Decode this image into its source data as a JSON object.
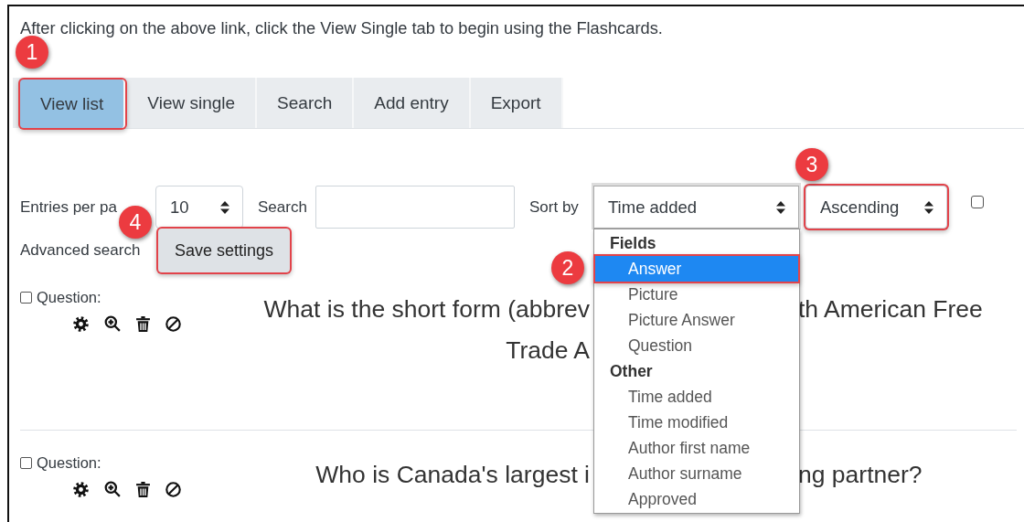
{
  "intro_text": "After clicking on the above link, click the View Single tab to begin using the Flashcards.",
  "tabs": [
    {
      "label": "View list",
      "selected": true,
      "highlighted": true,
      "badge": "1"
    },
    {
      "label": "View single",
      "selected": false,
      "highlighted": false
    },
    {
      "label": "Search",
      "selected": false,
      "highlighted": false
    },
    {
      "label": "Add entry",
      "selected": false,
      "highlighted": false
    },
    {
      "label": "Export",
      "selected": false,
      "highlighted": false
    }
  ],
  "controls": {
    "entries_label": "Entries per pa",
    "entries_select": {
      "value": "10"
    },
    "search_label": "Search",
    "sort_label": "Sort by",
    "sort_select": {
      "value": "Time added",
      "expanded": true
    },
    "order_select": {
      "value": "Ascending",
      "highlighted": true,
      "badge": "3"
    },
    "option_checkbox": {
      "checked": false
    },
    "advanced_label": "Advanced search",
    "save_button": {
      "label": "Save settings",
      "highlighted": true,
      "badge": "4"
    }
  },
  "sort_options": [
    {
      "kind": "group",
      "label": "Fields"
    },
    {
      "kind": "option",
      "label": "Answer",
      "selected": true,
      "highlighted": true,
      "badge": "2"
    },
    {
      "kind": "option",
      "label": "Picture",
      "selected": false,
      "highlighted": false
    },
    {
      "kind": "option",
      "label": "Picture Answer",
      "selected": false,
      "highlighted": false
    },
    {
      "kind": "option",
      "label": "Question",
      "selected": false,
      "highlighted": false
    },
    {
      "kind": "group",
      "label": "Other"
    },
    {
      "kind": "option",
      "label": "Time added",
      "selected": false,
      "highlighted": false
    },
    {
      "kind": "option",
      "label": "Time modified",
      "selected": false,
      "highlighted": false
    },
    {
      "kind": "option",
      "label": "Author first name",
      "selected": false,
      "highlighted": false
    },
    {
      "kind": "option",
      "label": "Author surname",
      "selected": false,
      "highlighted": false
    },
    {
      "kind": "option",
      "label": "Approved",
      "selected": false,
      "highlighted": false
    }
  ],
  "entries": [
    {
      "checked": false,
      "label": "Question:",
      "question_lines": [
        {
          "visible_start": "What is the short form (abbrev",
          "visible_end": "th American Free"
        },
        {
          "visible_start": "Trade A"
        }
      ]
    },
    {
      "checked": false,
      "label": "Question:",
      "question_lines": [
        {
          "visible_start": "Who is Canada's largest i",
          "visible_end": "ng partner?"
        }
      ]
    }
  ]
}
